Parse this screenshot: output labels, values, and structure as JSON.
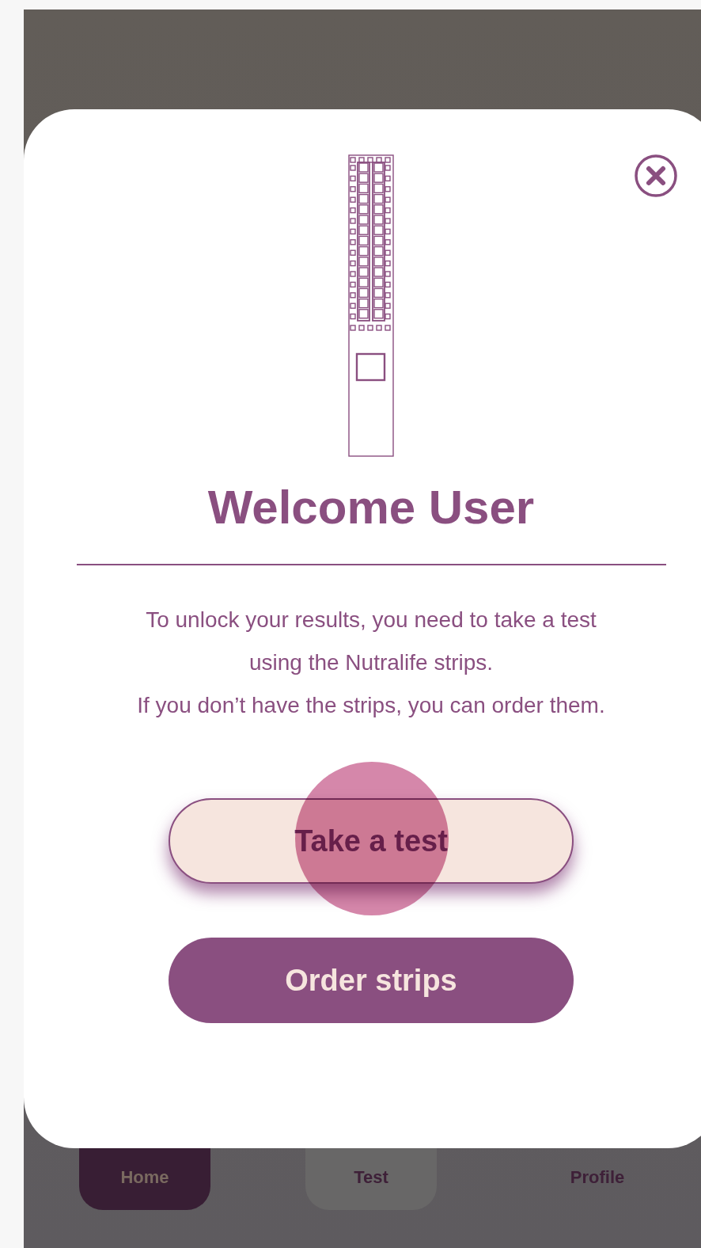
{
  "nav": [
    {
      "label": "Home",
      "selected": true
    },
    {
      "label": "Test",
      "selected": false
    },
    {
      "label": "Profile",
      "selected": false
    }
  ],
  "dialog": {
    "title": "Welcome User",
    "message_lines": [
      "To unlock your results, you need to take a test",
      "using the Nutralife strips.",
      "If you don’t have the strips, you can order them."
    ],
    "buttons": [
      {
        "label": "Take a test",
        "kind": "outline"
      },
      {
        "label": "Order strips",
        "kind": "filled"
      }
    ]
  }
}
